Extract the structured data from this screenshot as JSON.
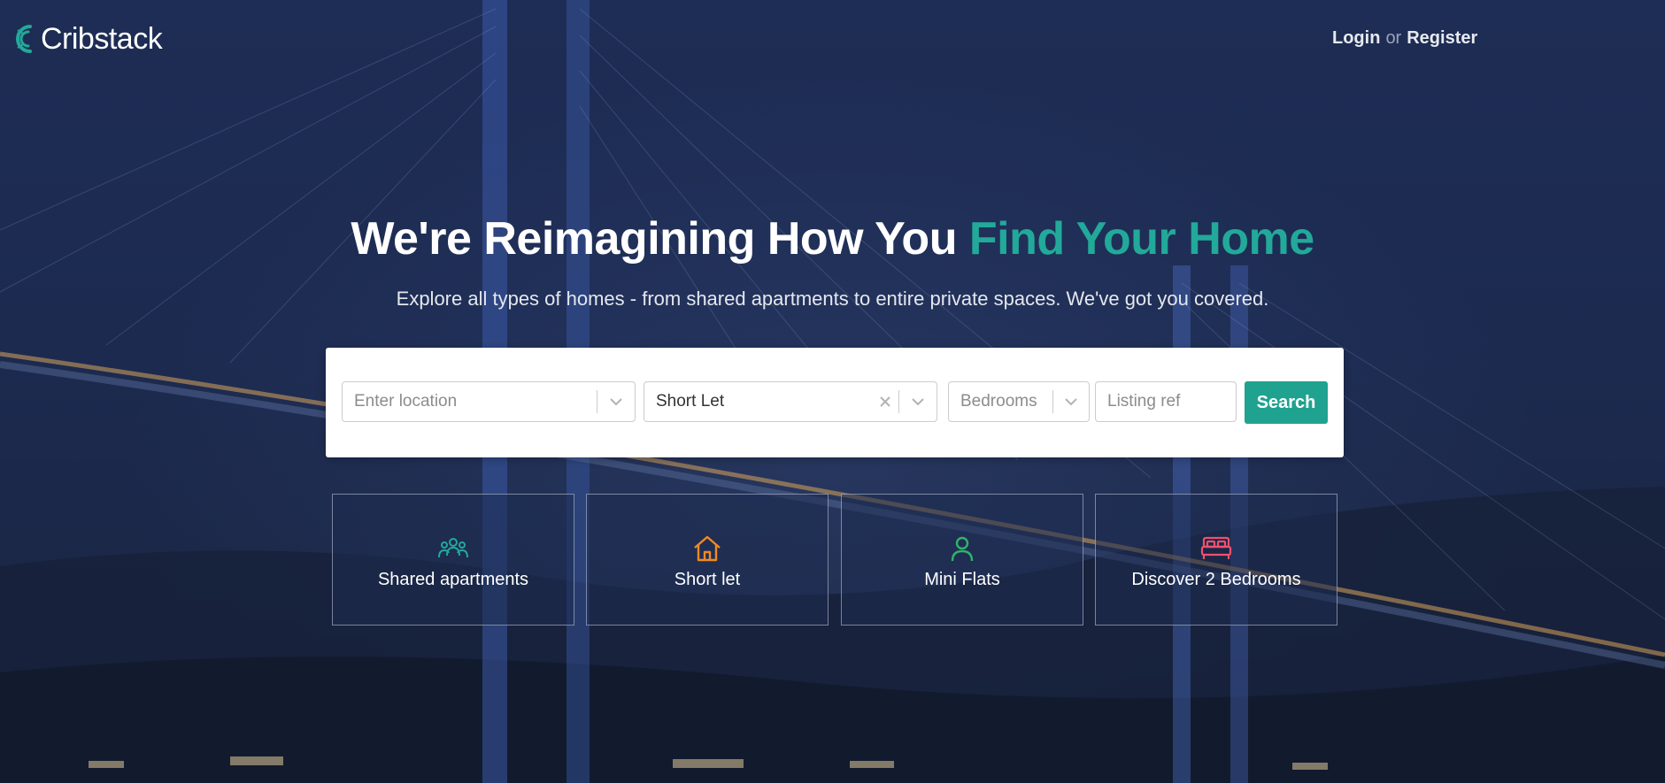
{
  "brand": {
    "name": "Cribstack",
    "accent": "#22a99a",
    "button_color": "#1fa290"
  },
  "header": {
    "login": "Login",
    "or": "or",
    "register": "Register"
  },
  "hero": {
    "title_main": "We're Reimagining How You ",
    "title_accent": "Find Your Home",
    "subtitle": "Explore all types of homes - from shared apartments to entire private spaces. We've got you covered."
  },
  "search": {
    "location_placeholder": "Enter location",
    "type_value": "Short Let",
    "bedrooms_placeholder": "Bedrooms",
    "listing_ref_placeholder": "Listing ref",
    "button": "Search"
  },
  "categories": [
    {
      "label": "Shared apartments",
      "icon": "people-group-icon",
      "color": "#22a99a"
    },
    {
      "label": "Short let",
      "icon": "house-icon",
      "color": "#f08a24"
    },
    {
      "label": "Mini Flats",
      "icon": "person-icon",
      "color": "#2fb36b"
    },
    {
      "label": "Discover 2 Bedrooms",
      "icon": "bed-icon",
      "color": "#f0506e"
    }
  ]
}
